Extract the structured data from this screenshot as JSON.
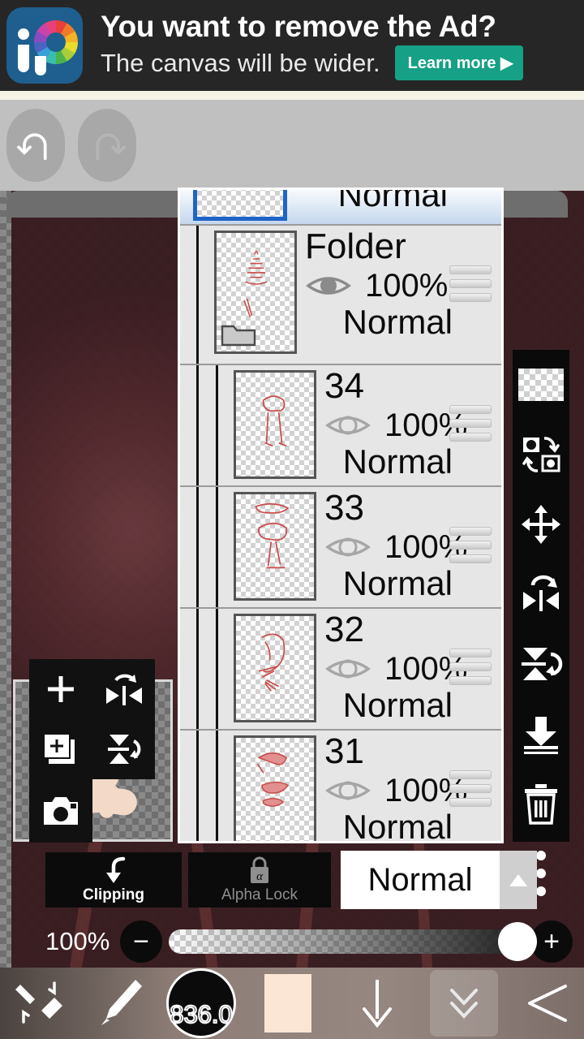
{
  "ad": {
    "line1": "You want to remove the Ad?",
    "line2": "The canvas will be wider.",
    "cta": "Learn more ▶",
    "logo_icon": "ibispaint-logo-icon"
  },
  "toolbar": {
    "undo_icon": "undo-arrow-icon",
    "redo_icon": "redo-arrow-icon"
  },
  "left_tools": {
    "add_layer_icon": "plus-icon",
    "duplicate_layer_icon": "duplicate-layer-icon",
    "flip_horizontal_icon": "flip-horizontal-icon",
    "flip_vertical_icon": "flip-vertical-icon",
    "camera_icon": "camera-icon"
  },
  "right_tools": [
    {
      "icon": "checkerboard-background-icon",
      "name": "background-layer-button"
    },
    {
      "icon": "swap-layers-icon",
      "name": "swap-layers-button"
    },
    {
      "icon": "move-layer-icon",
      "name": "move-layer-button"
    },
    {
      "icon": "rotate-flip-horizontal-icon",
      "name": "rotate-flip-horizontal-button"
    },
    {
      "icon": "rotate-flip-vertical-icon",
      "name": "rotate-flip-vertical-button"
    },
    {
      "icon": "merge-down-icon",
      "name": "merge-down-button"
    },
    {
      "icon": "trash-icon",
      "name": "delete-layer-button"
    },
    {
      "icon": "more-vertical-icon",
      "name": "more-options-button"
    }
  ],
  "layers_panel": {
    "selected_row": {
      "blend": "Normal"
    },
    "rows": [
      {
        "name": "Folder",
        "opacity": "100%",
        "blend": "Normal",
        "indent": 1,
        "is_folder": true,
        "visible": true,
        "eye_icon": "eye-visible-icon",
        "handle_icon": "drag-handle-icon"
      },
      {
        "name": "34",
        "opacity": "100%",
        "blend": "Normal",
        "indent": 2,
        "is_folder": false,
        "visible": false,
        "eye_icon": "eye-hidden-icon",
        "handle_icon": "drag-handle-icon"
      },
      {
        "name": "33",
        "opacity": "100%",
        "blend": "Normal",
        "indent": 2,
        "is_folder": false,
        "visible": false,
        "eye_icon": "eye-hidden-icon",
        "handle_icon": "drag-handle-icon"
      },
      {
        "name": "32",
        "opacity": "100%",
        "blend": "Normal",
        "indent": 2,
        "is_folder": false,
        "visible": false,
        "eye_icon": "eye-hidden-icon",
        "handle_icon": "drag-handle-icon"
      },
      {
        "name": "31",
        "opacity": "100%",
        "blend": "Normal",
        "indent": 2,
        "is_folder": false,
        "visible": false,
        "eye_icon": "eye-hidden-icon",
        "handle_icon": "drag-handle-icon"
      }
    ]
  },
  "bottom_controls": {
    "clipping_label": "Clipping",
    "clipping_icon": "clipping-arrow-icon",
    "alpha_lock_label": "Alpha Lock",
    "alpha_lock_icon": "alpha-lock-icon",
    "blend_mode_value": "Normal",
    "blend_mode_arrow_icon": "chevron-up-icon",
    "opacity_value": "100%",
    "opacity_minus_label": "−",
    "opacity_plus_label": "+"
  },
  "bottom_nav": {
    "undo_redo_icon": "brush-eraser-undo-icon",
    "brush_icon": "brush-icon",
    "brush_size_value": "836.0",
    "color_swatch_hex": "#fbe6d5",
    "down_arrow_icon": "down-arrow-icon",
    "collapse_icon": "double-chevron-down-icon",
    "back_icon": "back-arrow-icon"
  },
  "colors": {
    "ad_background": "#262626",
    "ad_cta": "#16a085",
    "toolbar_background": "#c0c0c0",
    "panel_background": "#e6e6e6",
    "selection_blue": "#1f63c8",
    "tool_strip": "#0a0a0a"
  }
}
